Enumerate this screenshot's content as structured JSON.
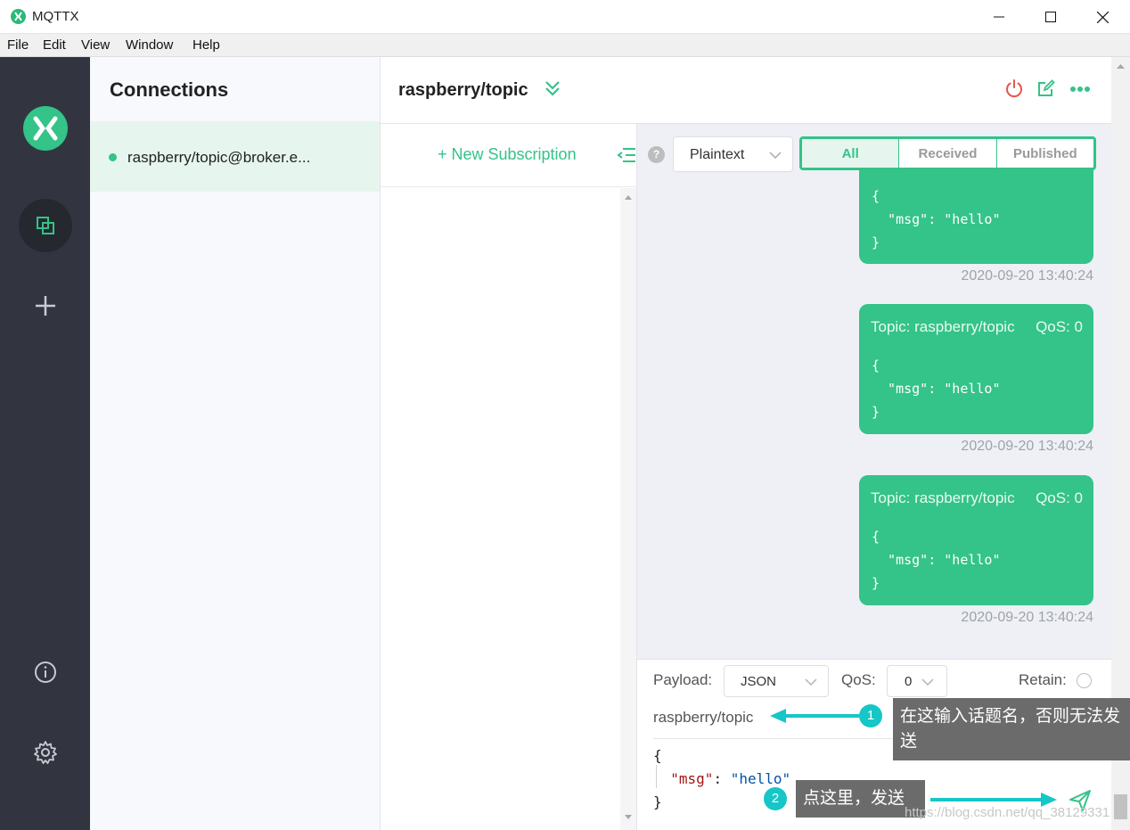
{
  "window": {
    "title": "MQTTX"
  },
  "menu": [
    "File",
    "Edit",
    "View",
    "Window",
    "Help"
  ],
  "connections": {
    "heading": "Connections",
    "items": [
      {
        "name": "raspberry/topic@broker.e...",
        "status": "connected"
      }
    ]
  },
  "header": {
    "title": "raspberry/topic"
  },
  "subscriptions": {
    "new_label": "New Subscription"
  },
  "messages": {
    "help": "?",
    "format": "Plaintext",
    "tabs": [
      "All",
      "Received",
      "Published"
    ],
    "active_tab": "All",
    "partial_payload": "{\n  \"msg\": \"hello\"\n}",
    "partial_time": "2020-09-20 13:40:24",
    "items": [
      {
        "topic": "Topic: raspberry/topic",
        "qos": "QoS: 0",
        "payload": "{\n  \"msg\": \"hello\"\n}",
        "time": "2020-09-20 13:40:24"
      },
      {
        "topic": "Topic: raspberry/topic",
        "qos": "QoS: 0",
        "payload": "{\n  \"msg\": \"hello\"\n}",
        "time": "2020-09-20 13:40:24"
      }
    ]
  },
  "publish": {
    "payload_label": "Payload:",
    "payload_format": "JSON",
    "qos_label": "QoS:",
    "qos_value": "0",
    "retain_label": "Retain:",
    "topic": "raspberry/topic",
    "payload_line1": "{",
    "payload_key": "\"msg\"",
    "payload_sep": ": ",
    "payload_val": "\"hello\"",
    "payload_line3": "}"
  },
  "annotations": [
    {
      "num": "1",
      "text": "在这输入话题名，否则无法发送"
    },
    {
      "num": "2",
      "text": "点这里，发送"
    }
  ],
  "watermark": "https://blog.csdn.net/qq_38129331",
  "colors": {
    "accent": "#34c388",
    "nav_bg": "#323540",
    "danger": "#e8544e",
    "annotation": "#17c6c6"
  }
}
